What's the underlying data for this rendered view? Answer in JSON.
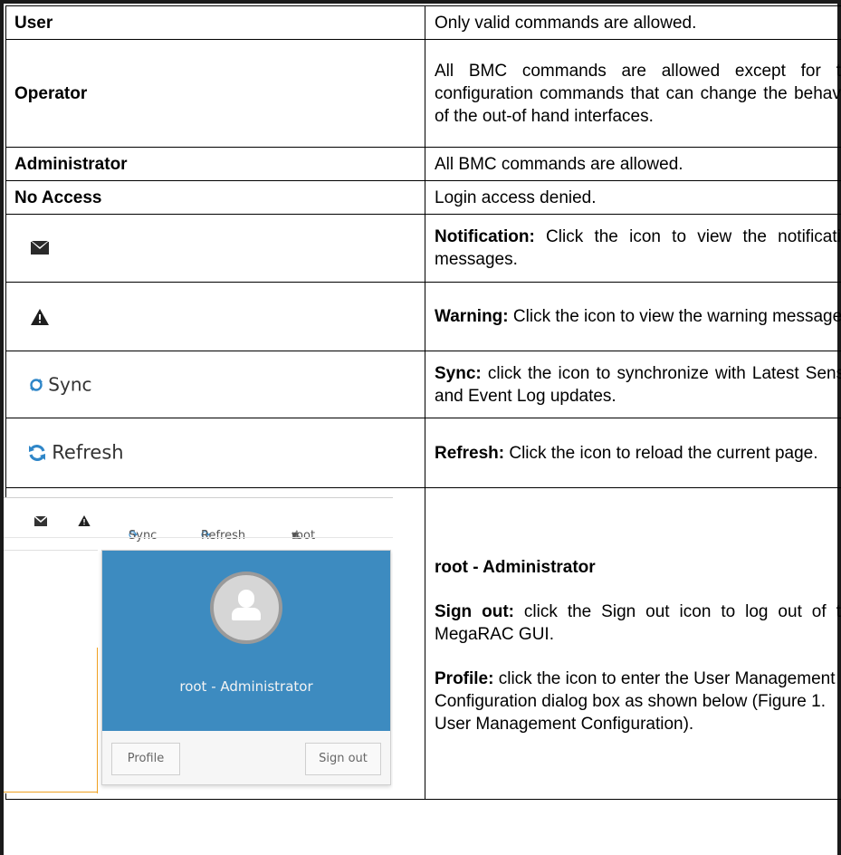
{
  "rows": [
    {
      "left": "User",
      "right": "Only valid commands are allowed."
    },
    {
      "left": "Operator",
      "right": "All BMC commands are allowed except for the configuration commands that can change the behavior of the out-of hand interfaces."
    },
    {
      "left": "Administrator",
      "right": "All BMC commands are allowed."
    },
    {
      "left": "No Access",
      "right": "Login access denied."
    }
  ],
  "icons": {
    "notification": {
      "icon": "envelope-icon",
      "term": "Notification:",
      "desc": " Click the icon to view the notification messages."
    },
    "warning": {
      "icon": "warning-icon",
      "term": "Warning:",
      "desc": " Click the icon to view the warning messages."
    },
    "sync": {
      "label": "Sync",
      "icon": "sync-icon",
      "term": "Sync:",
      "desc": " click the icon to synchronize with Latest Sensor and Event Log updates."
    },
    "refresh": {
      "label": "Refresh",
      "icon": "refresh-icon",
      "term": "Refresh:",
      "desc": " Click the icon to reload the current page."
    }
  },
  "user_menu": {
    "heading": "root - Administrator",
    "signout_term": "Sign out:",
    "signout_desc": " click the Sign out icon to log out of the MegaRAC GUI.",
    "profile_term": "Profile:",
    "profile_desc": " click the icon to enter the User Management Configuration dialog box as shown below (Figure 1. User Management Configuration).",
    "mock": {
      "sync": "Sync",
      "refresh": "Refresh",
      "user": "root",
      "panel_name": "root - Administrator",
      "profile_button": "Profile",
      "signout_button": "Sign out"
    }
  },
  "colors": {
    "panel_blue": "#3d8bc0",
    "icon_blue": "#2f86c8"
  }
}
